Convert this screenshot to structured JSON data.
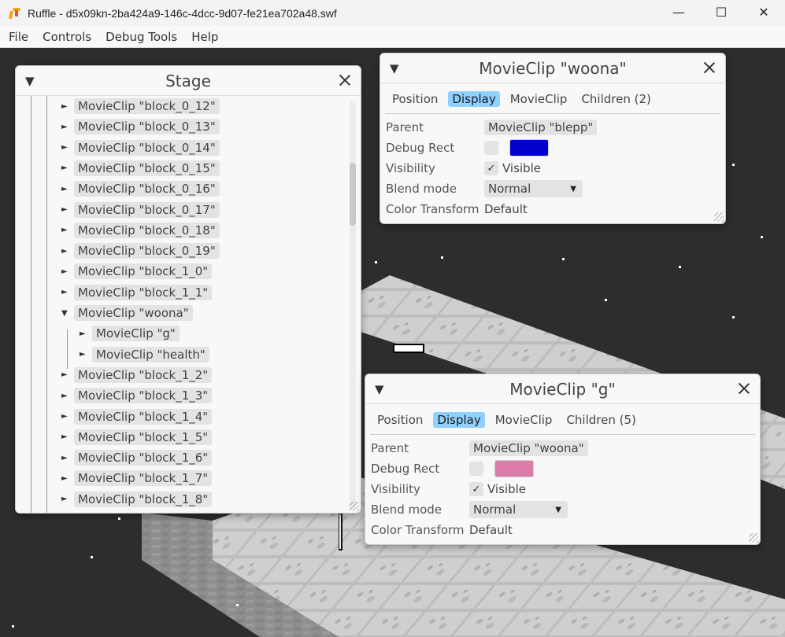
{
  "window": {
    "title": "Ruffle - d5x09kn-2ba424a9-146c-4dcc-9d07-fe21ea702a48.swf",
    "controls": {
      "minimize": "—",
      "maximize": "☐",
      "close": "✕"
    }
  },
  "menu": {
    "items": [
      "File",
      "Controls",
      "Debug Tools",
      "Help"
    ]
  },
  "stage": {
    "title": "Stage",
    "rows": [
      {
        "label": "MovieClip \"block_0_12\"",
        "arrow": "►",
        "depth": 0
      },
      {
        "label": "MovieClip \"block_0_13\"",
        "arrow": "►",
        "depth": 0
      },
      {
        "label": "MovieClip \"block_0_14\"",
        "arrow": "►",
        "depth": 0
      },
      {
        "label": "MovieClip \"block_0_15\"",
        "arrow": "►",
        "depth": 0
      },
      {
        "label": "MovieClip \"block_0_16\"",
        "arrow": "►",
        "depth": 0
      },
      {
        "label": "MovieClip \"block_0_17\"",
        "arrow": "►",
        "depth": 0
      },
      {
        "label": "MovieClip \"block_0_18\"",
        "arrow": "►",
        "depth": 0
      },
      {
        "label": "MovieClip \"block_0_19\"",
        "arrow": "►",
        "depth": 0
      },
      {
        "label": "MovieClip \"block_1_0\"",
        "arrow": "►",
        "depth": 0
      },
      {
        "label": "MovieClip \"block_1_1\"",
        "arrow": "►",
        "depth": 0
      },
      {
        "label": "MovieClip \"woona\"",
        "arrow": "▼",
        "depth": 0
      },
      {
        "label": "MovieClip \"g\"",
        "arrow": "►",
        "depth": 1
      },
      {
        "label": "MovieClip \"health\"",
        "arrow": "►",
        "depth": 1
      },
      {
        "label": "MovieClip \"block_1_2\"",
        "arrow": "►",
        "depth": 0
      },
      {
        "label": "MovieClip \"block_1_3\"",
        "arrow": "►",
        "depth": 0
      },
      {
        "label": "MovieClip \"block_1_4\"",
        "arrow": "►",
        "depth": 0
      },
      {
        "label": "MovieClip \"block_1_5\"",
        "arrow": "►",
        "depth": 0
      },
      {
        "label": "MovieClip \"block_1_6\"",
        "arrow": "►",
        "depth": 0
      },
      {
        "label": "MovieClip \"block_1_7\"",
        "arrow": "►",
        "depth": 0
      },
      {
        "label": "MovieClip \"block_1_8\"",
        "arrow": "►",
        "depth": 0
      }
    ]
  },
  "woona_panel": {
    "title": "MovieClip \"woona\"",
    "tabs": [
      "Position",
      "Display",
      "MovieClip",
      "Children (2)"
    ],
    "active_tab": 1,
    "labels": {
      "parent": "Parent",
      "debug_rect": "Debug Rect",
      "visibility": "Visibility",
      "blend_mode": "Blend mode",
      "color_transform": "Color Transform"
    },
    "parent": "MovieClip \"blepp\"",
    "debug_rect_color": "#0000c8",
    "visible_check": "✓",
    "visible_label": "Visible",
    "blend_mode": "Normal",
    "color_transform": "Default"
  },
  "g_panel": {
    "title": "MovieClip \"g\"",
    "tabs": [
      "Position",
      "Display",
      "MovieClip",
      "Children (5)"
    ],
    "active_tab": 1,
    "labels": {
      "parent": "Parent",
      "debug_rect": "Debug Rect",
      "visibility": "Visibility",
      "blend_mode": "Blend mode",
      "color_transform": "Color Transform"
    },
    "parent": "MovieClip \"woona\"",
    "debug_rect_color": "#dc7ca8",
    "visible_check": "✓",
    "visible_label": "Visible",
    "blend_mode": "Normal",
    "color_transform": "Default"
  },
  "icons": {
    "collapse": "▼",
    "dropdown": "▼"
  }
}
